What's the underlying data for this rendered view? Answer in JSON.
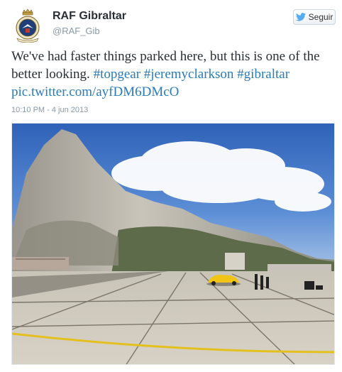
{
  "account": {
    "name": "RAF Gibraltar",
    "handle": "@RAF_Gib",
    "avatar_icon": "raf-crest-badge"
  },
  "follow_button": {
    "label": "Seguir",
    "icon": "twitter-bird-icon",
    "icon_color": "#55acee"
  },
  "tweet": {
    "text_intro": "We've had faster things parked here, but this is one of the better looking.",
    "hashtags": [
      "#topgear",
      "#jeremyclarkson",
      "#gibraltar"
    ],
    "link": "pic.twitter.com/ayfDM6DMcO",
    "timestamp": "10:10 PM - 4 jun 2013"
  },
  "colors": {
    "link": "#2b7bb9",
    "name": "#292f33",
    "muted": "#8899a6"
  }
}
